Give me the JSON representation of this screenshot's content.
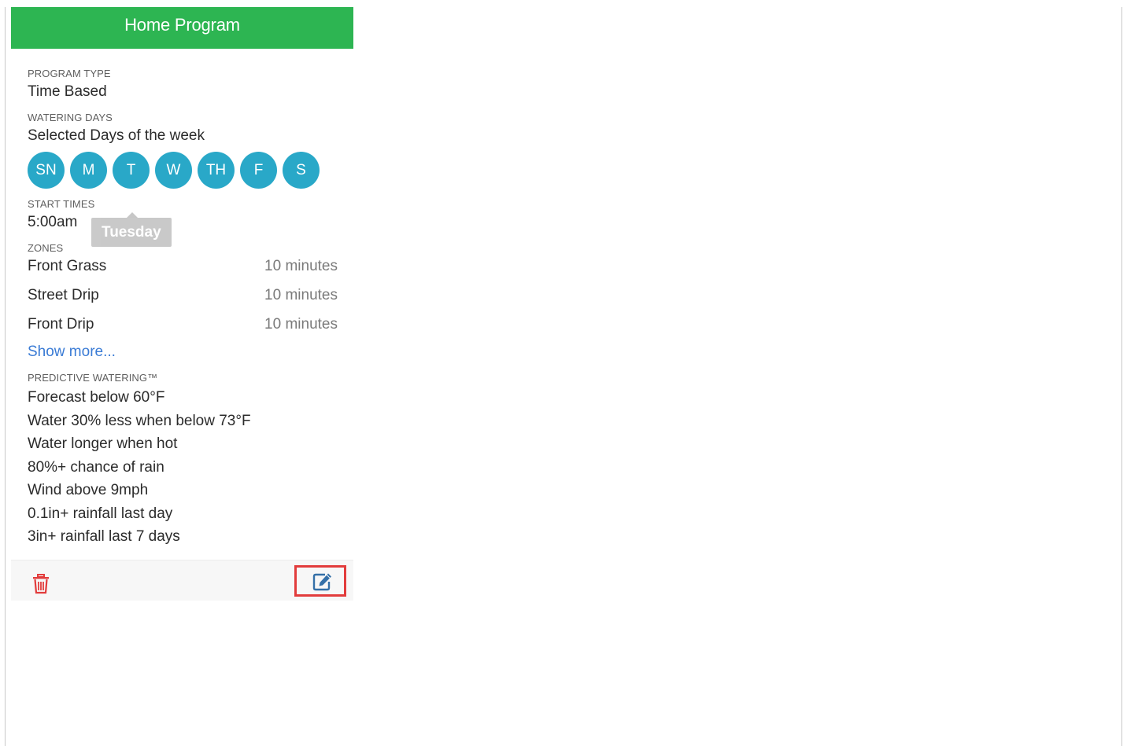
{
  "program": {
    "title": "Home Program",
    "program_type_label": "PROGRAM TYPE",
    "program_type_value": "Time Based",
    "watering_days_label": "WATERING DAYS",
    "watering_days_value": "Selected Days of the week",
    "days": [
      "SN",
      "M",
      "T",
      "W",
      "TH",
      "F",
      "S"
    ],
    "day_color": "#29a8c8",
    "tooltip": "Tuesday",
    "start_times_label": "START TIMES",
    "start_time": "5:00am",
    "zones_label": "ZONES",
    "zones": [
      {
        "name": "Front Grass",
        "duration": "10 minutes"
      },
      {
        "name": "Street Drip",
        "duration": "10 minutes"
      },
      {
        "name": "Front Drip",
        "duration": "10 minutes"
      }
    ],
    "show_more": "Show more...",
    "predictive_label": "PREDICTIVE WATERING™",
    "predictive": [
      "Forecast below 60°F",
      "Water 30% less when below 73°F",
      "Water longer when hot",
      "80%+ chance of rain",
      "Wind above 9mph",
      "0.1in+ rainfall last day",
      "3in+ rainfall last 7 days"
    ],
    "header_color": "#2db552",
    "footer_icons": [
      "trash-icon",
      "edit-icon"
    ]
  }
}
